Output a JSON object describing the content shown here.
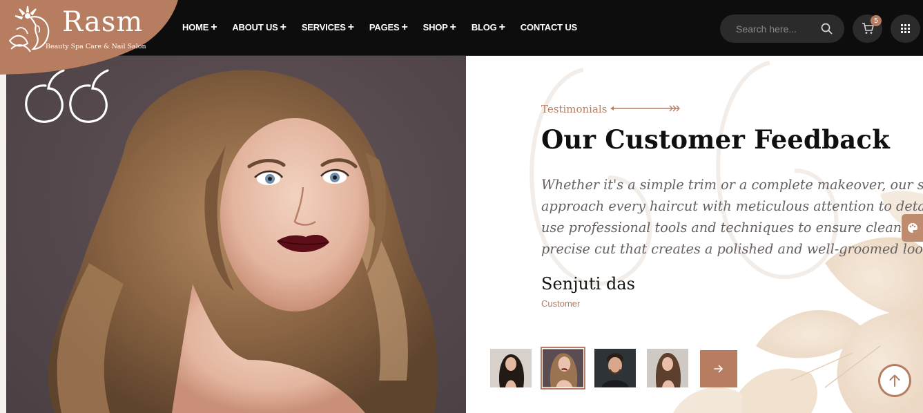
{
  "brand": {
    "name": "Rasm",
    "tagline": "Beauty Spa Care & Nail Salon",
    "accent_color": "#b77d60"
  },
  "nav": {
    "items": [
      {
        "label": "HOME",
        "has_submenu": true
      },
      {
        "label": "ABOUT US",
        "has_submenu": true
      },
      {
        "label": "SERVICES",
        "has_submenu": true
      },
      {
        "label": "PAGES",
        "has_submenu": true
      },
      {
        "label": "SHOP",
        "has_submenu": true
      },
      {
        "label": "BLOG",
        "has_submenu": true
      },
      {
        "label": "CONTACT US",
        "has_submenu": false
      }
    ],
    "submenu_symbol": "+"
  },
  "search": {
    "placeholder": "Search here...",
    "icon": "search-icon"
  },
  "cart": {
    "count": "5",
    "icon": "cart-icon"
  },
  "menu_grid": {
    "icon": "grid-icon"
  },
  "testimonial": {
    "eyebrow": "Testimonials",
    "heading": "Our Customer Feedback",
    "quote_lines": [
      "Whether it's a simple trim or a complete makeover, our stylists",
      "approach every haircut with meticulous attention to detail. We",
      "use professional tools and techniques to ensure clean lines and",
      "precise cut that creates a polished and well-groomed look."
    ],
    "author_name": "Senjuti das",
    "author_role": "Customer"
  },
  "thumbnails": {
    "items": [
      {
        "name": "thumbnail-1",
        "active": false
      },
      {
        "name": "thumbnail-2",
        "active": true
      },
      {
        "name": "thumbnail-3",
        "active": false
      },
      {
        "name": "thumbnail-4",
        "active": false
      }
    ],
    "next_icon": "arrow-right-icon"
  },
  "floating": {
    "palette_icon": "palette-icon",
    "scroll_top_icon": "arrow-up-icon"
  }
}
